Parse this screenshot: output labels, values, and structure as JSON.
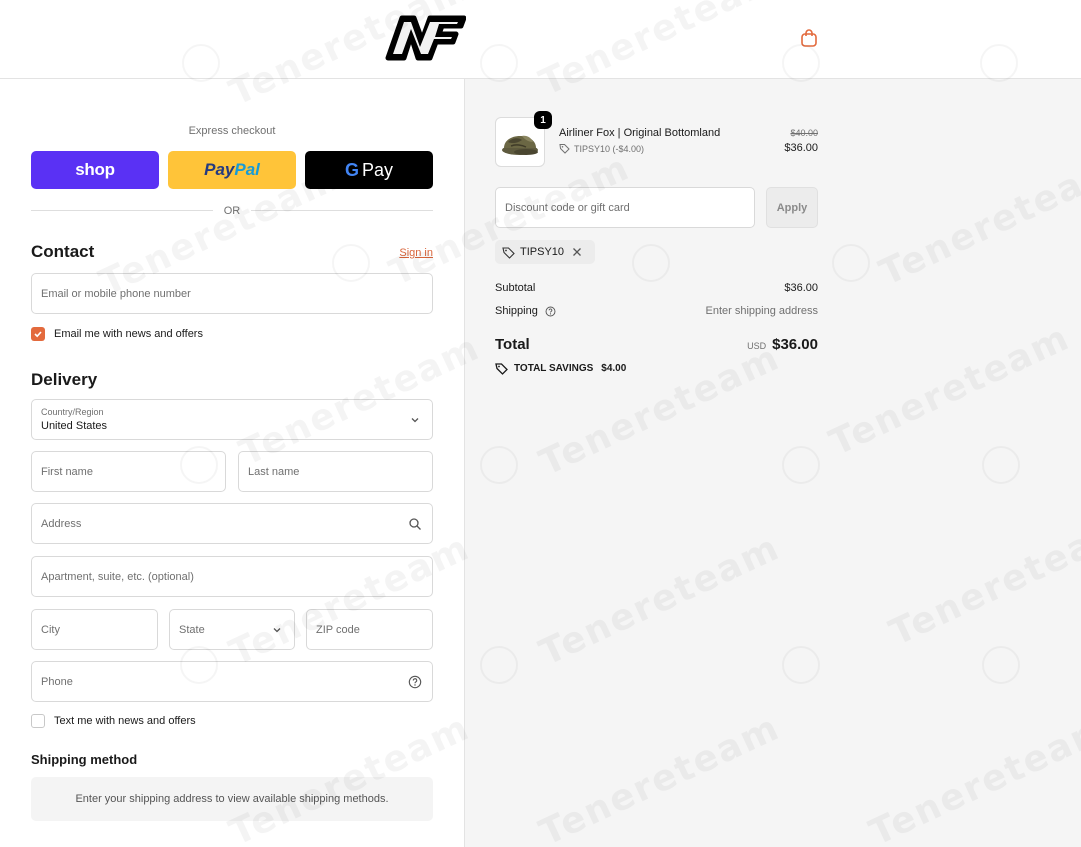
{
  "header": {
    "logo_text": "NF",
    "cart_icon": "shopping-bag-icon",
    "accent_color": "#e36a3d"
  },
  "express": {
    "label": "Express checkout",
    "shop_label": "shop",
    "paypal_label_1": "Pay",
    "paypal_label_2": "Pal",
    "gpay_g": "G",
    "gpay_label": "Pay",
    "or_label": "OR"
  },
  "contact": {
    "title": "Contact",
    "signin_label": "Sign in",
    "email_placeholder": "Email or mobile phone number",
    "news_label": "Email me with news and offers",
    "news_checked": true
  },
  "delivery": {
    "title": "Delivery",
    "country_label": "Country/Region",
    "country_value": "United States",
    "first_name_placeholder": "First name",
    "last_name_placeholder": "Last name",
    "address_placeholder": "Address",
    "apartment_placeholder": "Apartment, suite, etc. (optional)",
    "city_placeholder": "City",
    "state_placeholder": "State",
    "zip_placeholder": "ZIP code",
    "phone_placeholder": "Phone",
    "text_label": "Text me with news and offers",
    "text_checked": false
  },
  "shipping_method": {
    "title": "Shipping method",
    "message": "Enter your shipping address to view available shipping methods."
  },
  "summary": {
    "product": {
      "quantity": "1",
      "name": "Airliner Fox | Original Bottomland",
      "discount_note": "TIPSY10 (-$4.00)",
      "old_price": "$40.00",
      "new_price": "$36.00"
    },
    "discount_placeholder": "Discount code or gift card",
    "apply_label": "Apply",
    "applied_code": "TIPSY10",
    "subtotal_label": "Subtotal",
    "subtotal_value": "$36.00",
    "shipping_label": "Shipping",
    "shipping_value": "Enter shipping address",
    "total_label": "Total",
    "total_currency": "USD",
    "total_value": "$36.00",
    "savings_label": "TOTAL SAVINGS",
    "savings_value": "$4.00"
  },
  "watermark": {
    "text": "Tenereteam"
  }
}
